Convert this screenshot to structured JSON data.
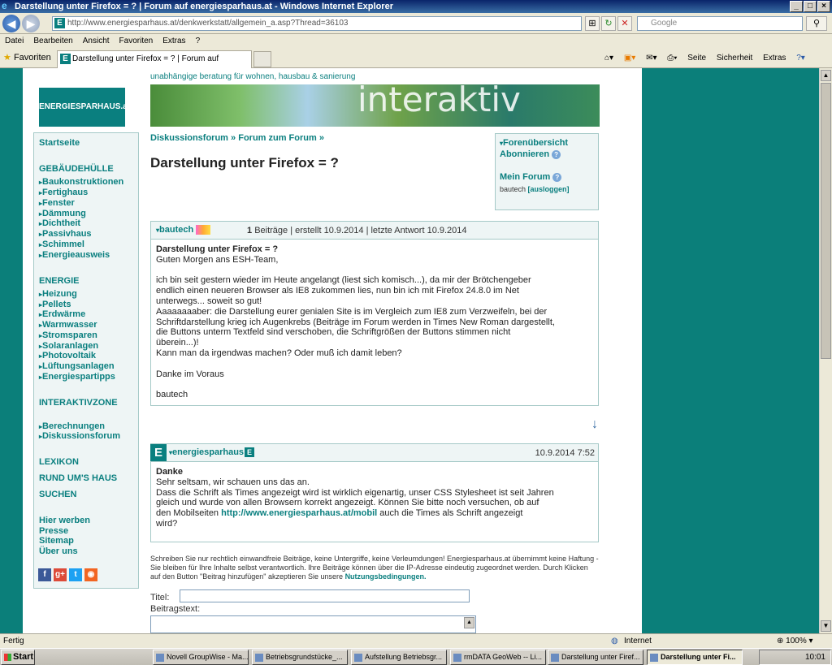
{
  "window": {
    "title": "Darstellung unter Firefox = ? | Forum auf energiesparhaus.at - Windows Internet Explorer"
  },
  "address": {
    "url": "http://www.energiesparhaus.at/denkwerkstatt/allgemein_a.asp?Thread=36103",
    "search_placeholder": "Google"
  },
  "menu": [
    "Datei",
    "Bearbeiten",
    "Ansicht",
    "Favoriten",
    "Extras",
    "?"
  ],
  "favbar": {
    "favorites": "Favoriten",
    "tab_title": "Darstellung unter Firefox = ? | Forum auf energiespar...",
    "tools": [
      "Seite",
      "Sicherheit",
      "Extras"
    ]
  },
  "site": {
    "tagline": "unabhängige beratung für wohnen, hausbau & sanierung",
    "logo": "ENERGIESPARHAUS.at",
    "banner_word": "interaktiv"
  },
  "sidebar": {
    "startseite": "Startseite",
    "gebaeude_header": "GEBÄUDEHÜLLE",
    "gebaeude": [
      "Baukonstruktionen",
      "Fertighaus",
      "Fenster",
      "Dämmung",
      "Dichtheit",
      "Passivhaus",
      "Schimmel",
      "Energieausweis"
    ],
    "energie_header": "ENERGIE",
    "energie": [
      "Heizung",
      "Pellets",
      "Erdwärme",
      "Warmwasser",
      "Stromsparen",
      "Solaranlagen",
      "Photovoltaik",
      "Lüftungsanlagen",
      "Energiespartipps"
    ],
    "interaktiv_header": "INTERAKTIVZONE",
    "interaktiv": [
      "Berechnungen",
      "Diskussionsforum"
    ],
    "lexikon": "LEXIKON",
    "rund": "RUND UM'S HAUS",
    "suchen": "SUCHEN",
    "footer_links": [
      "Hier werben",
      "Presse",
      "Sitemap",
      "Über uns"
    ]
  },
  "breadcrumb": {
    "a": "Diskussionsforum",
    "sep": "»",
    "b": "Forum zum Forum"
  },
  "page_title": "Darstellung unter Firefox = ?",
  "rightbox": {
    "overview": "Forenübersicht",
    "subscribe": "Abonnieren",
    "myforum": "Mein Forum",
    "user": "bautech",
    "logout": "[ausloggen]"
  },
  "post1": {
    "author": "bautech",
    "count": "1",
    "meta": "Beiträge | erstellt 10.9.2014 | letzte Antwort 10.9.2014",
    "subject": "Darstellung unter Firefox = ?",
    "text": "Guten Morgen ans ESH-Team,\n\nich bin seit gestern wieder im Heute angelangt (liest sich komisch...), da mir der Brötchengeber\nendlich einen neueren Browser als IE8 zukommen lies, nun bin ich mit Firefox 24.8.0 im Net\nunterwegs... soweit so gut!\nAaaaaaaaber: die Darstellung eurer genialen Site is im Vergleich zum IE8 zum Verzweifeln, bei der\nSchriftdarstellung krieg ich Augenkrebs (Beiträge im Forum werden in Times New Roman dargestellt,\ndie Buttons unterm Textfeld sind verschoben, die Schriftgrößen der Buttons stimmen nicht\nüberein...)!\nKann man da irgendwas machen? Oder muß ich damit leben?\n\nDanke im Voraus\n\nbautech"
  },
  "post2": {
    "author": "energiesparhaus",
    "date": "10.9.2014 7:52",
    "subject": "Danke",
    "text_a": "Sehr seltsam, wir schauen uns das an.\nDass die Schrift als Times angezeigt wird ist wirklich eigenartig, unser CSS Stylesheet ist seit Jahren\ngleich und wurde von allen Browsern korrekt angezeigt. Können Sie bitte noch versuchen, ob auf\nden Mobilseiten ",
    "link": "http://www.energiesparhaus.at/mobil",
    "text_b": " auch die Times als Schrift angezeigt\nwird?"
  },
  "disclaimer": {
    "text": "Schreiben Sie nur rechtlich einwandfreie Beiträge, keine Untergriffe, keine Verleumdungen! Energiesparhaus.at übernimmt keine Haftung - Sie bleiben für Ihre Inhalte selbst verantwortlich. Ihre Beiträge können über die IP-Adresse eindeutig zugeordnet werden. Durch Klicken auf den Button \"Beitrag hinzufügen\" akzeptieren Sie unsere ",
    "link": "Nutzungsbedingungen."
  },
  "form": {
    "title_label": "Titel:",
    "text_label": "Beitragstext:"
  },
  "status": {
    "left": "Fertig",
    "zone": "Internet",
    "zoom": "100%"
  },
  "taskbar": {
    "start": "Start",
    "tasks": [
      "Novell GroupWise - Ma...",
      "Betriebsgrundstücke_...",
      "Aufstellung Betriebsgr...",
      "rmDATA GeoWeb -- Li...",
      "Darstellung unter Firef...",
      "Darstellung unter Fi..."
    ],
    "clock": "10:01"
  }
}
